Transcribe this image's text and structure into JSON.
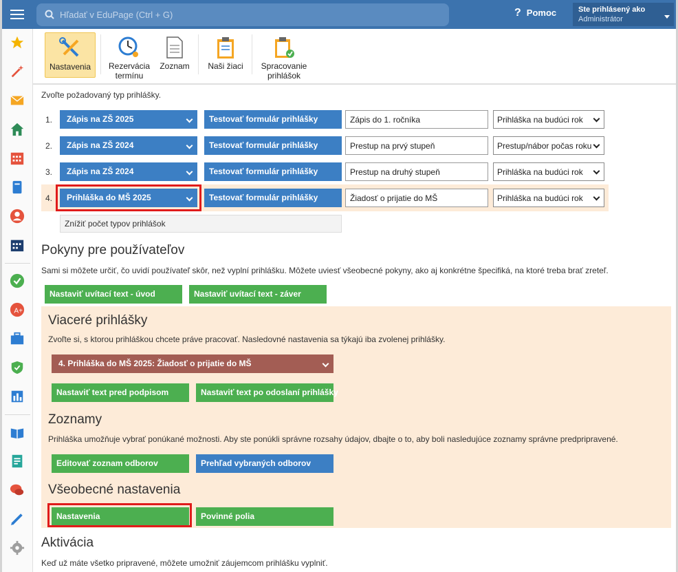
{
  "topbar": {
    "search_placeholder": "Hľadať v EduPage (Ctrl + G)",
    "help_label": "Pomoc",
    "help_glyph": "?",
    "user_label": "Ste prihlásený ako",
    "user_name": "Administrátor"
  },
  "toolbar": {
    "items": [
      {
        "label1": "Nastavenia",
        "label2": ""
      },
      {
        "label1": "Rezervácia",
        "label2": "termínu"
      },
      {
        "label1": "Zoznam",
        "label2": ""
      },
      {
        "label1": "Naši žiaci",
        "label2": ""
      },
      {
        "label1": "Spracovanie",
        "label2": "prihlášok"
      }
    ]
  },
  "content": {
    "intro": "Zvoľte požadovaný typ prihlášky.",
    "rows": [
      {
        "num": "1.",
        "type": "Zápis na ZŠ 2025",
        "test": "Testovať formulár prihlášky",
        "name": "Zápis do 1. ročníka",
        "kind": "Prihláška na budúci rok"
      },
      {
        "num": "2.",
        "type": "Zápis na ZŠ 2024",
        "test": "Testovať formulár prihlášky",
        "name": "Prestup na prvý stupeň",
        "kind": "Prestup/nábor počas roku"
      },
      {
        "num": "3.",
        "type": "Zápis na ZŠ 2024",
        "test": "Testovať formulár prihlášky",
        "name": "Prestup na druhý stupeň",
        "kind": "Prihláška na budúci rok"
      },
      {
        "num": "4.",
        "type": "Prihláška do MŠ 2025",
        "test": "Testovať formulár prihlášky",
        "name": "Žiadosť o prijatie do MŠ",
        "kind": "Prihláška na budúci rok"
      }
    ],
    "reduce_label": "Znížiť počet typov prihlášok",
    "pokyny_title": "Pokyny pre používateľov",
    "pokyny_desc": "Sami si môžete určiť, čo uvidí používateľ skôr, než vyplní prihlášku. Môžete uviesť všeobecné pokyny, ako aj konkrétne špecifiká, na ktoré treba brať zreteľ.",
    "btn_intro": "Nastaviť uvítací text - úvod",
    "btn_outro": "Nastaviť uvítací text - záver",
    "multi_title": "Viaceré prihlášky",
    "multi_desc": "Zvoľte si, s ktorou prihláškou chcete práve pracovať. Nasledovné nastavenia sa týkajú iba zvolenej prihlášky.",
    "multi_selected": "4. Prihláška do MŠ 2025: Žiadosť o prijatie do MŠ",
    "btn_before_sign": "Nastaviť text pred podpisom",
    "btn_after_send": "Nastaviť text po odoslaní prihlášky",
    "lists_title": "Zoznamy",
    "lists_desc": "Prihláška umožňuje vybrať ponúkané možnosti. Aby ste ponúkli správne rozsahy údajov, dbajte o to, aby boli nasledujúce zoznamy správne predpripravené.",
    "btn_edit_list": "Editovať zoznam odborov",
    "btn_overview": "Prehľad vybraných odborov",
    "general_title": "Všeobecné nastavenia",
    "btn_settings": "Nastavenia",
    "btn_required": "Povinné polia",
    "activation_title": "Aktivácia",
    "activation_desc": "Keď už máte všetko pripravené, môžete umožniť záujemcom prihlášku vyplniť."
  },
  "colors": {
    "topbar": "#3c73ae",
    "blue_button": "#3c7fc4",
    "green_button": "#4caf50",
    "selected_app": "#a35d54",
    "panel_bg": "#fdebd8",
    "highlight": "#e01b1b"
  }
}
